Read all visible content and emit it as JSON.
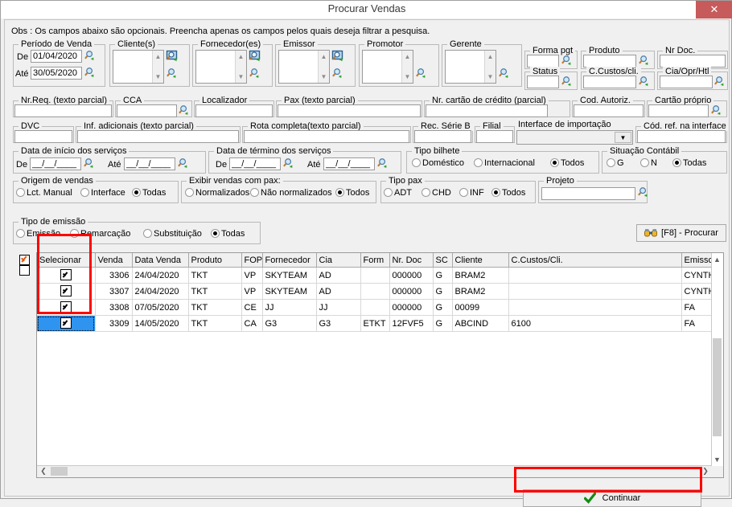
{
  "window": {
    "title": "Procurar Vendas",
    "close_label": "✕"
  },
  "obs_text": "Obs : Os campos abaixo são opcionais. Preencha apenas os campos pelos quais deseja filtrar a pesquisa.",
  "groups": {
    "periodo_venda": {
      "caption": "Período de Venda",
      "de_label": "De",
      "de_value": "01/04/2020",
      "ate_label": "Até",
      "ate_value": "30/05/2020"
    },
    "clientes": {
      "caption": "Cliente(s)",
      "value": ""
    },
    "fornecedores": {
      "caption": "Fornecedor(es)",
      "value": ""
    },
    "emissor": {
      "caption": "Emissor",
      "value": ""
    },
    "promotor": {
      "caption": "Promotor",
      "value": ""
    },
    "gerente": {
      "caption": "Gerente",
      "value": ""
    },
    "forma_pgt": {
      "caption": "Forma pgt",
      "value": ""
    },
    "status": {
      "caption": "Status",
      "value": ""
    },
    "produto": {
      "caption": "Produto",
      "value": ""
    },
    "ccustos_cli": {
      "caption": "C.Custos/cli.",
      "value": ""
    },
    "nr_doc": {
      "caption": "Nr Doc.",
      "value": ""
    },
    "cia_opr_htl": {
      "caption": "Cia/Opr/Htl",
      "value": ""
    },
    "nr_req": {
      "caption": "Nr.Req. (texto parcial)",
      "value": ""
    },
    "cca": {
      "caption": "CCA",
      "value": ""
    },
    "localizador": {
      "caption": "Localizador",
      "value": ""
    },
    "pax": {
      "caption": "Pax (texto parcial)",
      "value": ""
    },
    "nr_cartao_credito": {
      "caption": "Nr. cartão de crédito (parcial)",
      "value": ""
    },
    "cod_autoriz": {
      "caption": "Cod. Autoriz.",
      "value": ""
    },
    "cartao_proprio": {
      "caption": "Cartão próprio",
      "value": ""
    },
    "dvc": {
      "caption": "DVC",
      "value": ""
    },
    "inf_adicionais": {
      "caption": "Inf. adicionais (texto parcial)",
      "value": ""
    },
    "rota_completa": {
      "caption": "Rota completa(texto parcial)",
      "value": ""
    },
    "rec_serie_b": {
      "caption": "Rec. Série B",
      "value": ""
    },
    "filial": {
      "caption": "Filial",
      "value": ""
    },
    "interface_importacao": {
      "caption": "Interface de importação",
      "value": ""
    },
    "cod_ref_interface": {
      "caption": "Cód. ref. na interface",
      "value": ""
    },
    "data_inicio": {
      "caption": "Data de início dos serviços",
      "de_label": "De",
      "de_value": "__/__/____",
      "ate_label": "Até",
      "ate_value": "__/__/____"
    },
    "data_termino": {
      "caption": "Data de término dos serviços",
      "de_label": "De",
      "de_value": "__/__/____",
      "ate_label": "Até",
      "ate_value": "__/__/____"
    },
    "tipo_bilhete": {
      "caption": "Tipo bilhete",
      "options": [
        "Doméstico",
        "Internacional",
        "Todos"
      ],
      "selected": "Todos"
    },
    "situacao_contabil": {
      "caption": "Situação Contábil",
      "options": [
        "G",
        "N",
        "Todas"
      ],
      "selected": "Todas"
    },
    "origem_vendas": {
      "caption": "Origem de vendas",
      "options": [
        "Lct. Manual",
        "Interface",
        "Todas"
      ],
      "selected": "Todas"
    },
    "exibir_vendas_pax": {
      "caption": "Exibir vendas com pax:",
      "options": [
        "Normalizados",
        "Não normalizados",
        "Todos"
      ],
      "selected": "Todos"
    },
    "tipo_pax": {
      "caption": "Tipo pax",
      "options": [
        "ADT",
        "CHD",
        "INF",
        "Todos"
      ],
      "selected": "Todos"
    },
    "projeto": {
      "caption": "Projeto",
      "value": ""
    },
    "tipo_emissao": {
      "caption": "Tipo de emissão",
      "options": [
        "Emissão",
        "Remarcação",
        "Substituição",
        "Todas"
      ],
      "selected": "Todas"
    }
  },
  "buttons": {
    "procurar": "[F8] - Procurar",
    "continuar": "Continuar"
  },
  "grid": {
    "columns": [
      "Selecionar",
      "Venda",
      "Data Venda",
      "Produto",
      "FOP",
      "Fornecedor",
      "Cia",
      "Form",
      "Nr. Doc",
      "SC",
      "Cliente",
      "C.Custos/Cli.",
      "Emissor"
    ],
    "rows": [
      {
        "selected": true,
        "venda": "3306",
        "data_venda": "24/04/2020",
        "produto": "TKT",
        "fop": "VP",
        "fornecedor": "SKYTEAM",
        "cia": "AD",
        "form": "",
        "nr_doc": "000000",
        "sc": "G",
        "cliente": "BRAM2",
        "ccustos": "",
        "emissor": "CYNTHIA",
        "active": false
      },
      {
        "selected": true,
        "venda": "3307",
        "data_venda": "24/04/2020",
        "produto": "TKT",
        "fop": "VP",
        "fornecedor": "SKYTEAM",
        "cia": "AD",
        "form": "",
        "nr_doc": "000000",
        "sc": "G",
        "cliente": "BRAM2",
        "ccustos": "",
        "emissor": "CYNTHIA",
        "active": false
      },
      {
        "selected": true,
        "venda": "3308",
        "data_venda": "07/05/2020",
        "produto": "TKT",
        "fop": "CE",
        "fornecedor": "JJ",
        "cia": "JJ",
        "form": "",
        "nr_doc": "000000",
        "sc": "G",
        "cliente": "00099",
        "ccustos": "",
        "emissor": "FA",
        "active": false
      },
      {
        "selected": true,
        "venda": "3309",
        "data_venda": "14/05/2020",
        "produto": "TKT",
        "fop": "CA",
        "fornecedor": "G3",
        "cia": "G3",
        "form": "ETKT",
        "nr_doc": "12FVF5",
        "sc": "G",
        "cliente": "ABCIND",
        "ccustos": "6100",
        "emissor": "FA",
        "active": true
      }
    ]
  },
  "colors": {
    "accent_red": "#ff0000",
    "close_red": "#c75b5b",
    "selected_row": "#2f93f0",
    "face": "#f0f0f0"
  }
}
